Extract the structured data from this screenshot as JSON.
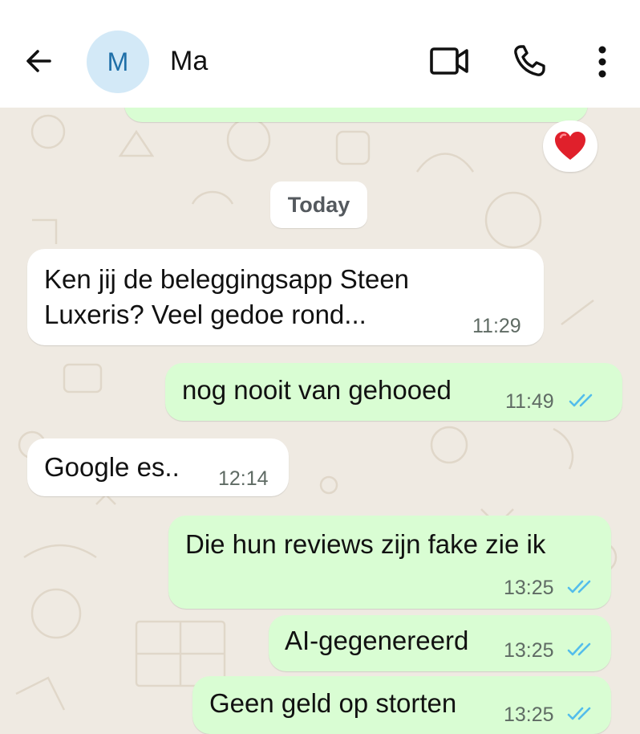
{
  "header": {
    "back_icon": "arrow-left-icon",
    "avatar_initial": "M",
    "contact_name": "Ma",
    "video_icon": "video-camera-icon",
    "call_icon": "phone-icon",
    "menu_icon": "more-vertical-icon"
  },
  "reaction": {
    "icon": "red-heart-icon"
  },
  "date_divider": "Today",
  "messages": [
    {
      "direction": "incoming",
      "lines": [
        "Ken jij de beleggingsapp Steen",
        "Luxeris?   Veel gedoe rond..."
      ],
      "time": "11:29"
    },
    {
      "direction": "outgoing",
      "text": "nog nooit van gehooed",
      "time": "11:49",
      "status": "read"
    },
    {
      "direction": "incoming",
      "text": "Google es..",
      "time": "12:14"
    },
    {
      "direction": "outgoing",
      "text": "Die hun reviews zijn fake zie ik",
      "time": "13:25",
      "status": "read"
    },
    {
      "direction": "outgoing",
      "text": "AI-gegenereerd",
      "time": "13:25",
      "status": "read"
    },
    {
      "direction": "outgoing",
      "text": "Geen geld op storten",
      "time": "13:25",
      "status": "read"
    }
  ],
  "colors": {
    "header_bg": "#ffffff",
    "chat_bg": "#efeae2",
    "incoming_bubble": "#ffffff",
    "outgoing_bubble": "#d9fdd3",
    "read_ticks": "#53bdeb",
    "avatar_bg": "#d3e9f7",
    "avatar_text": "#1f6fa8"
  }
}
